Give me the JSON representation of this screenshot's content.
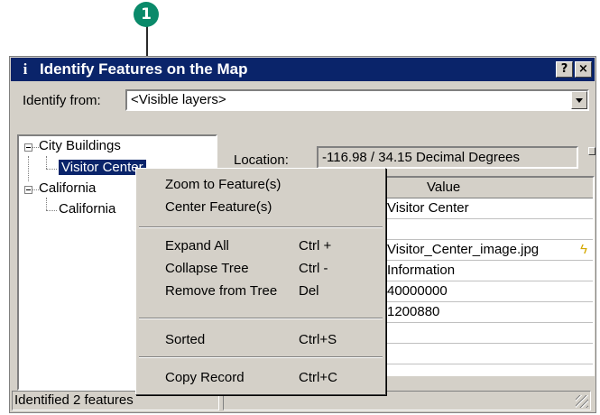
{
  "callout": {
    "number": "1"
  },
  "window": {
    "title": "Identify Features on the Map",
    "title_icon": "i",
    "help_label": "?",
    "close_label": "×"
  },
  "identify": {
    "label": "Identify from:",
    "value": "<Visible layers>"
  },
  "tree": {
    "nodes": [
      {
        "label": "City Buildings",
        "children": [
          "Visitor Center"
        ]
      },
      {
        "label": "California",
        "children": [
          "California"
        ]
      }
    ],
    "selected_label": "Visitor Center"
  },
  "location": {
    "label": "Location:",
    "value": "-116.98 / 34.15 Decimal Degrees"
  },
  "grid": {
    "header": "Value",
    "rows": [
      "Visitor Center",
      "",
      "Visitor_Center_image.jpg",
      "Information",
      "40000000",
      "1200880",
      "",
      ""
    ]
  },
  "status": {
    "text": "Identified 2 features"
  },
  "context_menu": {
    "items": [
      {
        "label": "Zoom to Feature(s)",
        "shortcut": ""
      },
      {
        "label": "Center Feature(s)",
        "shortcut": ""
      },
      {
        "label": "Expand All",
        "shortcut": "Ctrl +"
      },
      {
        "label": "Collapse Tree",
        "shortcut": "Ctrl -"
      },
      {
        "label": "Remove from Tree",
        "shortcut": "Del"
      },
      {
        "label": "Sorted",
        "shortcut": "Ctrl+S"
      },
      {
        "label": "Copy Record",
        "shortcut": "Ctrl+C"
      }
    ]
  },
  "colors": {
    "titlebar": "#0a246a",
    "selection": "#0a246a",
    "callout": "#0a8a6a",
    "face": "#d4d0c8"
  }
}
